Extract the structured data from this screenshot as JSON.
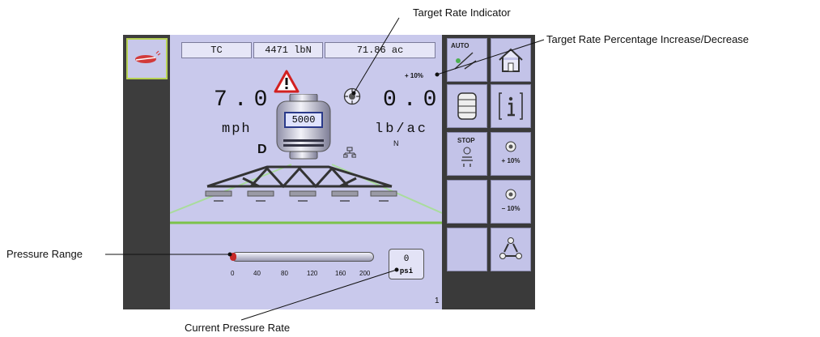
{
  "callouts": {
    "target_rate_indicator": "Target Rate Indicator",
    "target_rate_pct": "Target Rate Percentage Increase/Decrease",
    "pressure_range": "Pressure Range",
    "current_pressure_rate": "Current Pressure Rate"
  },
  "header": {
    "control": "TC",
    "product": "4471 lbN",
    "area": "71.86 ac"
  },
  "speed": {
    "value": "7.0",
    "unit": "mph"
  },
  "rate": {
    "value": "0.0",
    "unit": "lb/ac",
    "product_code": "N",
    "adjust_pct": "+ 10%"
  },
  "tank": {
    "volume": "5000"
  },
  "mode_letter": "D",
  "pressure": {
    "ticks": [
      "0",
      "40",
      "80",
      "120",
      "160",
      "200"
    ],
    "value": "0",
    "unit": "psi",
    "level": 0
  },
  "page_number": "1",
  "buttons": {
    "auto_label": "AUTO",
    "stop_label": "STOP",
    "increase_label": "+ 10%",
    "decrease_label": "− 10%"
  },
  "colors": {
    "screen_bg": "#c9c9ec",
    "button_bg": "#c3c3e8",
    "accent_green": "#7bc24a",
    "warning_red": "#d22020"
  }
}
